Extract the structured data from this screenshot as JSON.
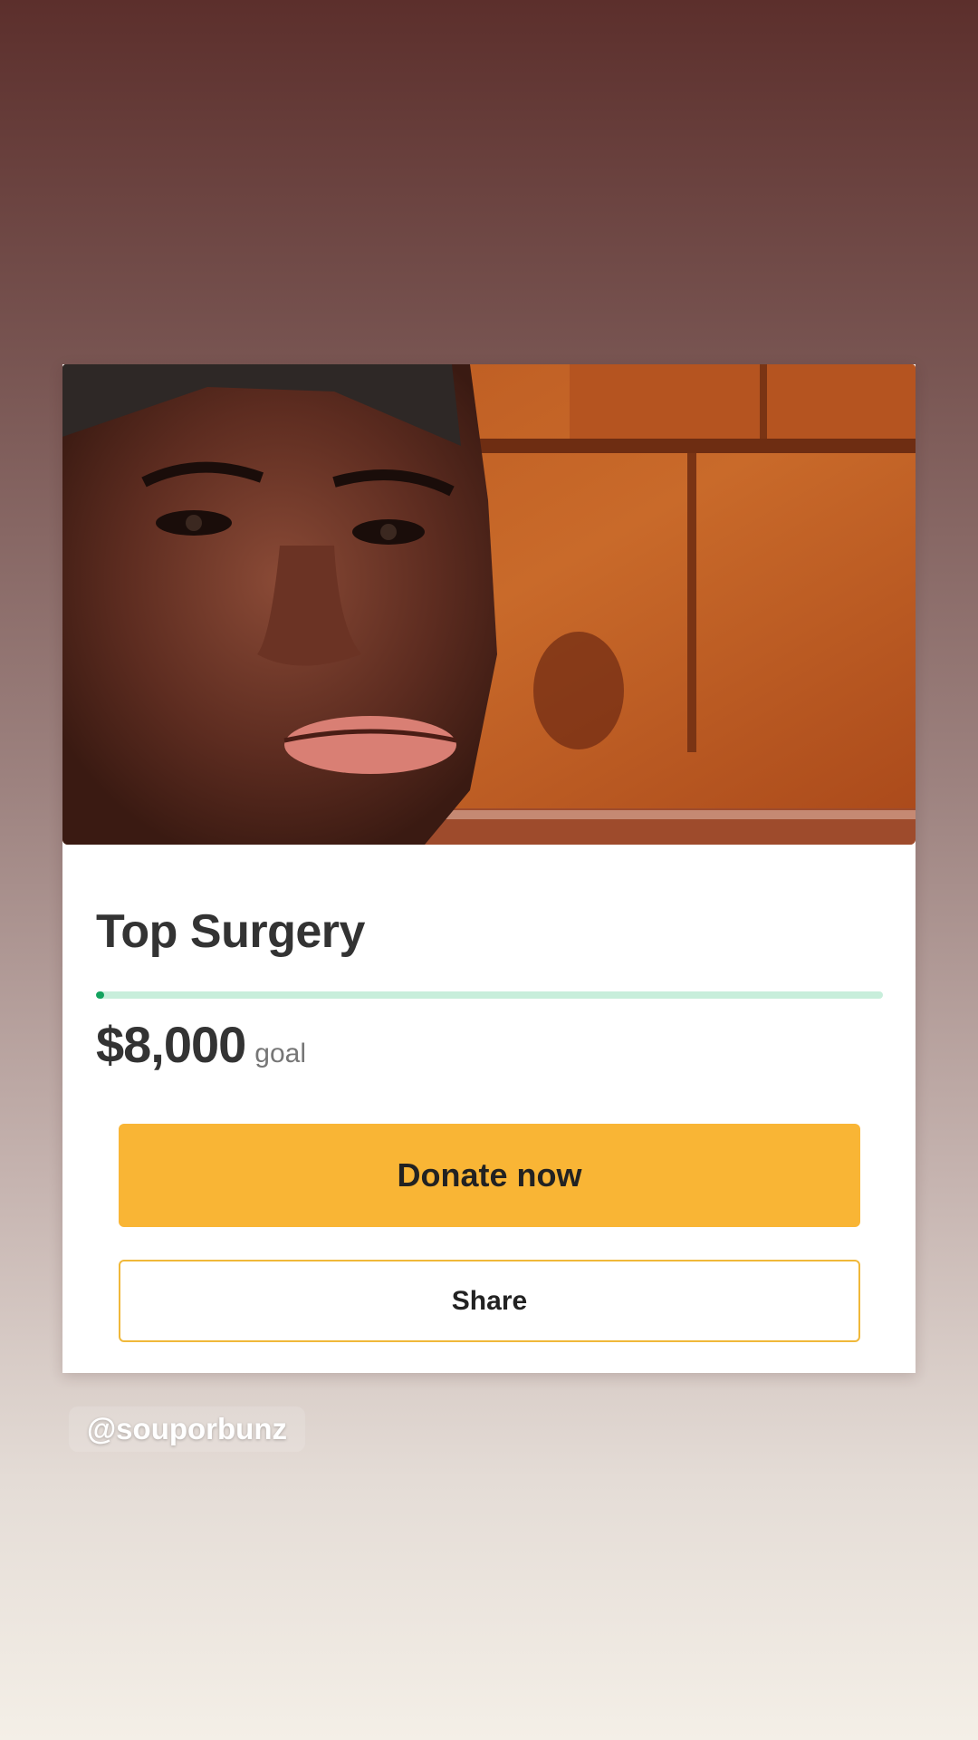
{
  "fundraiser": {
    "title": "Top Surgery",
    "goal_amount": "$8,000",
    "goal_label": "goal",
    "progress_fraction": 0.01,
    "donate_label": "Donate now",
    "share_label": "Share"
  },
  "story": {
    "mention": "@souporbunz"
  },
  "colors": {
    "donate_button": "#f9b535",
    "share_border": "#f0b83a",
    "progress_track": "#c8eedb",
    "progress_fill": "#14a35f"
  }
}
